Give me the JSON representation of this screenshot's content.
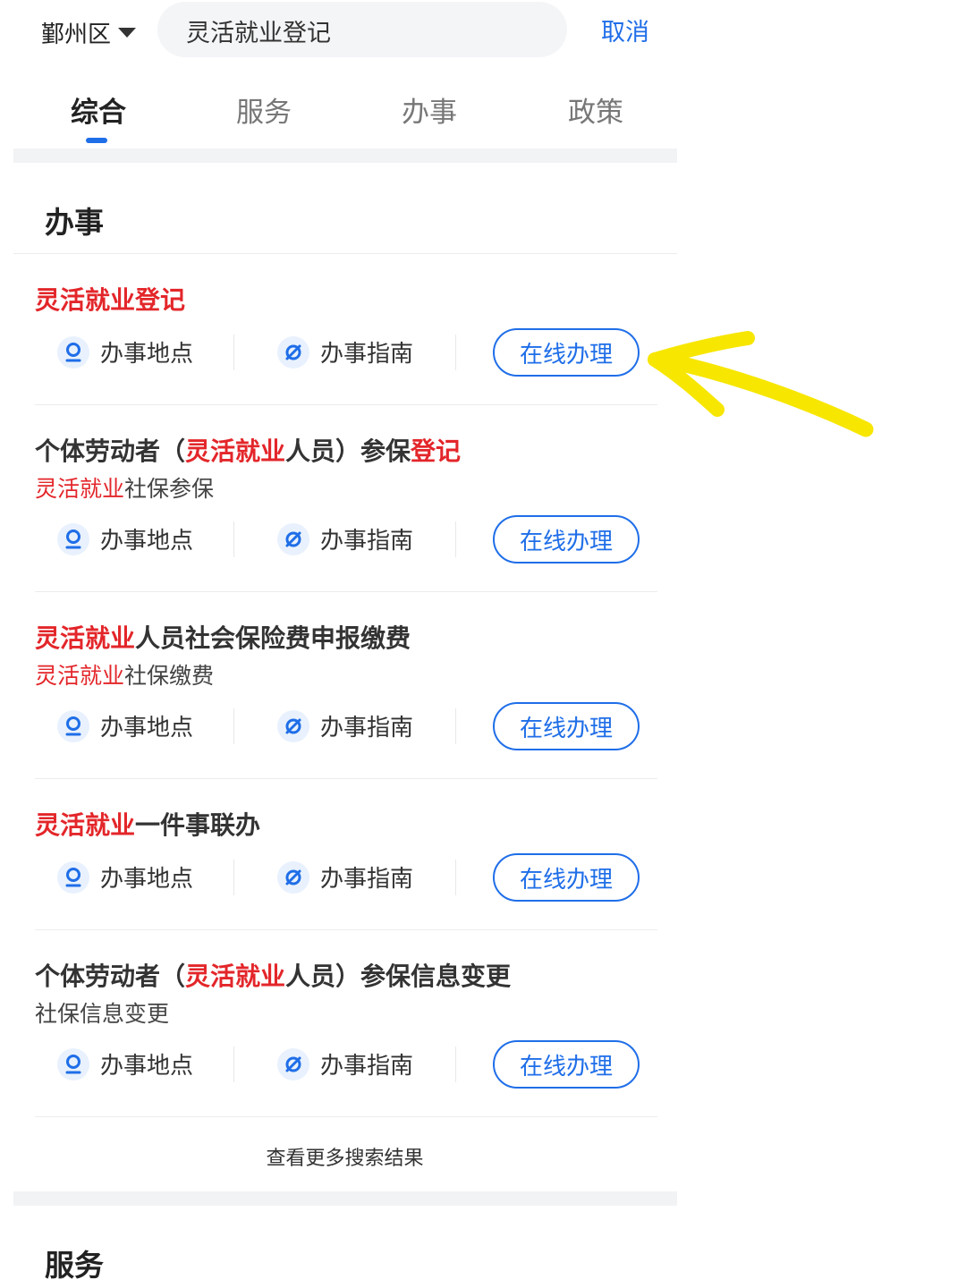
{
  "header": {
    "district": "鄞州区",
    "search_value": "灵活就业登记",
    "cancel_label": "取消"
  },
  "tabs": [
    {
      "label": "综合",
      "active": true
    },
    {
      "label": "服务",
      "active": false
    },
    {
      "label": "办事",
      "active": false
    },
    {
      "label": "政策",
      "active": false
    }
  ],
  "section_affairs": {
    "title": "办事"
  },
  "actions": {
    "location": "办事地点",
    "guide": "办事指南",
    "online": "在线办理"
  },
  "items": [
    {
      "title_parts": [
        {
          "text": "灵活就业登记",
          "hl": true
        }
      ],
      "subtitle_parts": []
    },
    {
      "title_parts": [
        {
          "text": "个体劳动者（",
          "hl": false
        },
        {
          "text": "灵活就业",
          "hl": true
        },
        {
          "text": "人员）参保",
          "hl": false
        },
        {
          "text": "登记",
          "hl": true
        }
      ],
      "subtitle_parts": [
        {
          "text": "灵活就业",
          "hl": true
        },
        {
          "text": "社保参保",
          "hl": false
        }
      ]
    },
    {
      "title_parts": [
        {
          "text": "灵活就业",
          "hl": true
        },
        {
          "text": "人员社会保险费申报缴费",
          "hl": false
        }
      ],
      "subtitle_parts": [
        {
          "text": "灵活就业",
          "hl": true
        },
        {
          "text": "社保缴费",
          "hl": false
        }
      ]
    },
    {
      "title_parts": [
        {
          "text": "灵活就业",
          "hl": true
        },
        {
          "text": "一件事联办",
          "hl": false
        }
      ],
      "subtitle_parts": []
    },
    {
      "title_parts": [
        {
          "text": "个体劳动者（",
          "hl": false
        },
        {
          "text": "灵活就业",
          "hl": true
        },
        {
          "text": "人员）参保信息变更",
          "hl": false
        }
      ],
      "subtitle_parts": [
        {
          "text": "社保信息变更",
          "hl": false
        }
      ]
    }
  ],
  "more_results": "查看更多搜索结果",
  "section_services": {
    "title": "服务"
  },
  "colors": {
    "accent": "#1f6ee8",
    "highlight": "#e3262a",
    "annotation_arrow": "#f7e600"
  },
  "annotation": {
    "icon": "arrow-pointing-left-icon"
  }
}
